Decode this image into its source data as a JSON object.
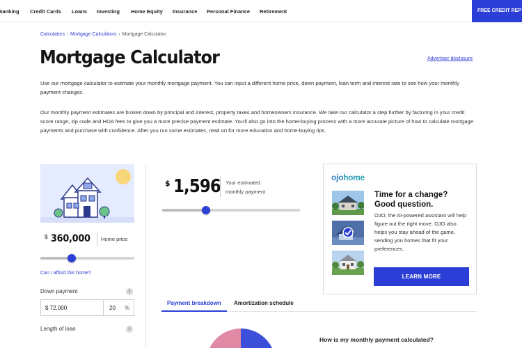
{
  "nav": {
    "items": [
      "Banking",
      "Credit Cards",
      "Loans",
      "Investing",
      "Home Equity",
      "Insurance",
      "Personal Finance",
      "Retirement"
    ],
    "cta_label": "FREE CREDIT REP"
  },
  "breadcrumb": {
    "items": [
      "Calculators",
      "Mortgage Calculators",
      "Mortgage Calculator"
    ],
    "separator": "›"
  },
  "page": {
    "title": "Mortgage Calculator",
    "advertiser_disclosure": "Advertiser disclosure",
    "intro_1": "Use our mortgage calculator to estimate your monthly mortgage payment. You can input a different home price, down payment, loan term and interest rate to see how your monthly payment changes.",
    "intro_2": "Our monthly payment estimates are broken down by principal and interest, property taxes and homeowners insurance. We take our calculator a step further by factoring in your credit score range, zip code and HOA fees to give you a more precise payment estimate. You'll also go into the home-buying process with a more accurate picture of how to calculate mortgage payments and purchase with confidence. After you run some estimates, read on for more education and home-buying tips."
  },
  "calculator": {
    "currency": "$",
    "home_price": "360,000",
    "home_price_label": "Home price",
    "home_price_slider_fraction": 0.33,
    "afford_link": "Can I afford this home?",
    "down_payment_label": "Down payment",
    "info_icon": "i",
    "down_payment_amount": "$ 72,000",
    "down_payment_percent": "20",
    "percent_sign": "%",
    "loan_length_label": "Length of loan"
  },
  "result": {
    "currency": "$",
    "monthly_payment": "1,596",
    "monthly_payment_label": "Your estimated monthly payment",
    "slider_fraction": 0.32
  },
  "tabs": {
    "items": [
      "Payment breakdown",
      "Amortization schedule"
    ],
    "active": 0,
    "breakdown_question": "How is my monthly payment calculated?"
  },
  "ad": {
    "logo_part1": "ojo",
    "logo_part2": "home",
    "headline_1": "Time for a change?",
    "headline_2": "Good question.",
    "body": "OJO, the AI-powered assistant will help figure out the right move. OJO also helps you stay ahead of the game, sending you homes that fit your preferences.",
    "cta_label": "LEARN MORE"
  },
  "colors": {
    "accent": "#2b3fd6",
    "link": "#2d3bd1",
    "house_bg": "#e6ecff",
    "chart_pink": "#e08aa6"
  }
}
